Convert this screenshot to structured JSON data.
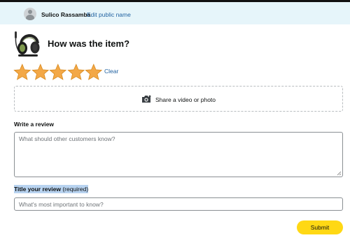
{
  "profile": {
    "name": "Sulico Rassamba",
    "edit_link": "Edit public name"
  },
  "product": {
    "image_icon": "headset-image"
  },
  "rating": {
    "question": "How was the item?",
    "stars_total": 5,
    "stars_selected": 5,
    "star_color": "#f3a847",
    "clear_label": "Clear"
  },
  "media": {
    "icon": "camera-icon",
    "label": "Share a video or photo"
  },
  "review": {
    "label": "Write a review",
    "placeholder": "What should other customers know?",
    "value": ""
  },
  "title": {
    "label": "Title your review",
    "required_note": "(required)",
    "placeholder": "What's most important to know?",
    "value": ""
  },
  "submit_label": "Submit",
  "colors": {
    "profile_bar": "#e6f5fa",
    "link": "#2162a1",
    "submit": "#ffd814",
    "highlight": "#b8d3f0"
  }
}
